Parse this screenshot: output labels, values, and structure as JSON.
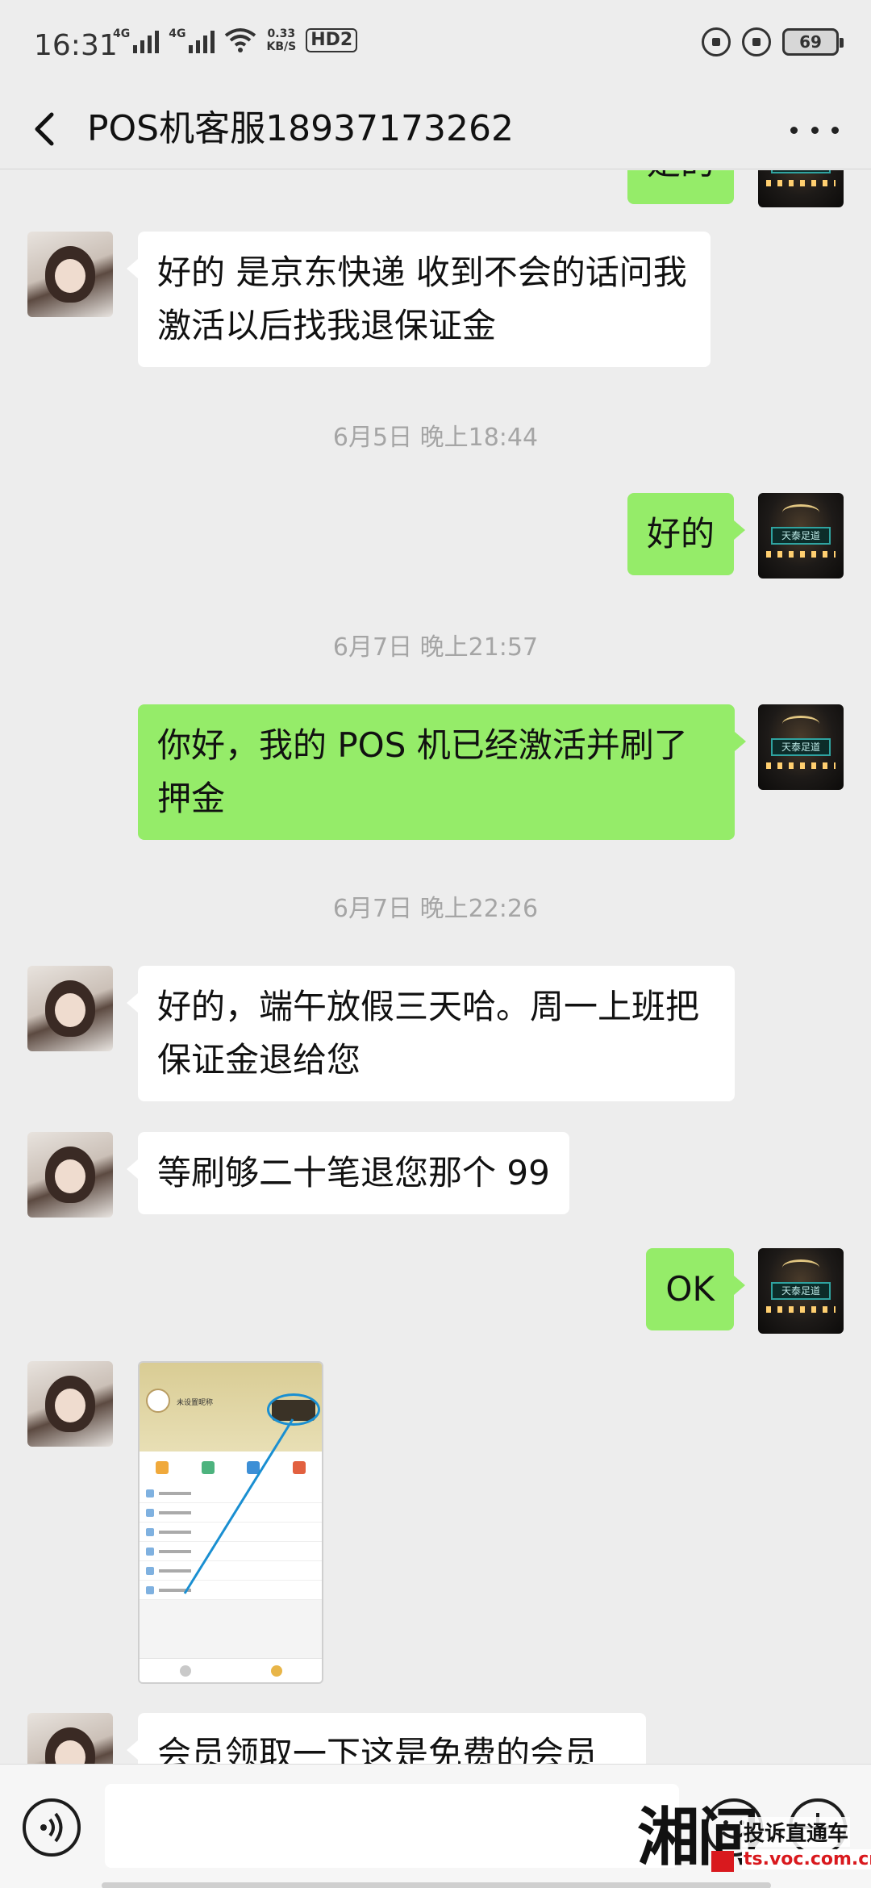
{
  "status_bar": {
    "time": "16:31",
    "network_1": "4G",
    "network_2": "4G",
    "speed_value": "0.33",
    "speed_unit": "KB/S",
    "hd": "HD2",
    "battery": "69"
  },
  "header": {
    "title": "POS机客服18937173262"
  },
  "messages": [
    {
      "side": "out",
      "text": "是的"
    },
    {
      "side": "in",
      "text": "好的 是京东快递  收到不会的话问我 激活以后找我退保证金"
    },
    {
      "type": "time",
      "text": "6月5日 晚上18:44"
    },
    {
      "side": "out",
      "text": "好的"
    },
    {
      "type": "time",
      "text": "6月7日 晚上21:57"
    },
    {
      "side": "out",
      "text": "你好，我的 POS 机已经激活并刷了押金"
    },
    {
      "type": "time",
      "text": "6月7日 晚上22:26"
    },
    {
      "side": "in",
      "text": "好的，端午放假三天哈。周一上班把保证金退给您"
    },
    {
      "side": "in",
      "text": "等刷够二十笔退您那个 99"
    },
    {
      "side": "out",
      "text": "OK"
    },
    {
      "side": "in",
      "type": "image",
      "image_caption": "未设置昵称"
    },
    {
      "side": "in",
      "text": "会员领取一下这是免费的会员"
    }
  ],
  "avatar_me_sign": "天泰足道",
  "watermark": {
    "logo": "湘问",
    "line1": "投诉直通车",
    "line2": "ts.voc.com.cn"
  },
  "colors": {
    "background": "#ededed",
    "bubble_out": "#95ec69",
    "bubble_in": "#ffffff",
    "timestamp": "#a5a5a5",
    "watermark_red": "#d9191e"
  },
  "icons": {
    "back": "chevron-left-icon",
    "more": "more-dots-icon",
    "voice": "voice-icon",
    "emoji": "emoji-icon",
    "plus": "plus-icon"
  }
}
